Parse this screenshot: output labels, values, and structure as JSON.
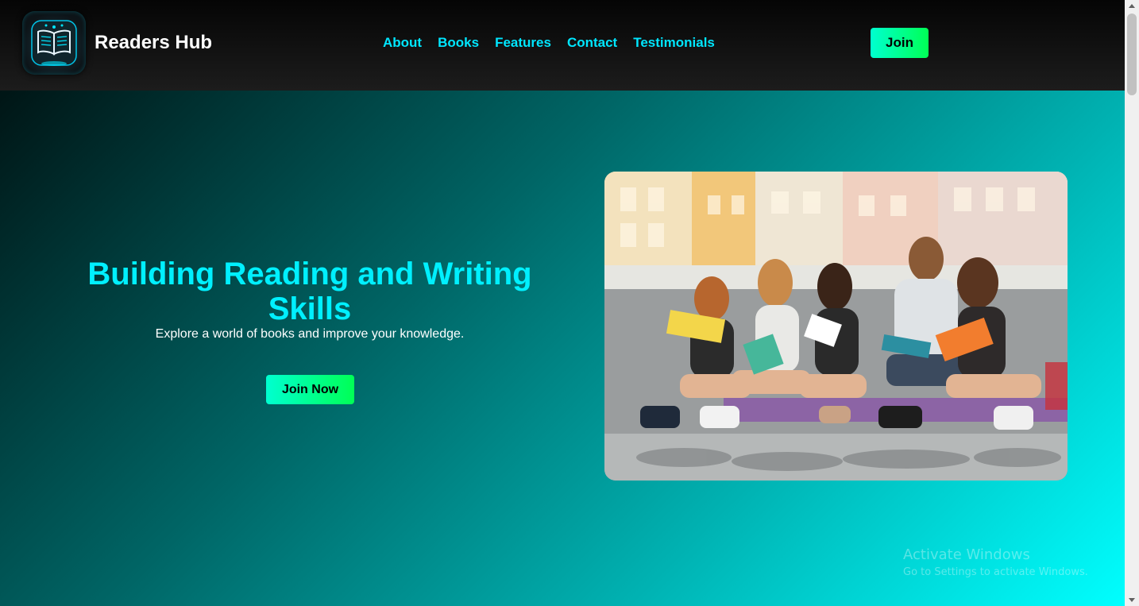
{
  "header": {
    "brand": "Readers Hub",
    "logo_icon": "open-book-icon",
    "nav": [
      {
        "label": "About"
      },
      {
        "label": "Books"
      },
      {
        "label": "Features"
      },
      {
        "label": "Contact"
      },
      {
        "label": "Testimonials"
      }
    ],
    "join_label": "Join"
  },
  "hero": {
    "title": "Building Reading and Writing Skills",
    "subtitle": "Explore a world of books and improve your knowledge.",
    "cta_label": "Join Now",
    "image_alt": "Group of friends reading books outdoors"
  },
  "watermark": {
    "line1": "Activate Windows",
    "line2": "Go to Settings to activate Windows."
  },
  "colors": {
    "accent_cyan": "#00e6ff",
    "button_gradient_start": "#00ffd0",
    "button_gradient_end": "#00ff55",
    "header_bg": "#0a0a0a",
    "hero_gradient_dark": "#001515",
    "hero_gradient_light": "#00ffff"
  }
}
